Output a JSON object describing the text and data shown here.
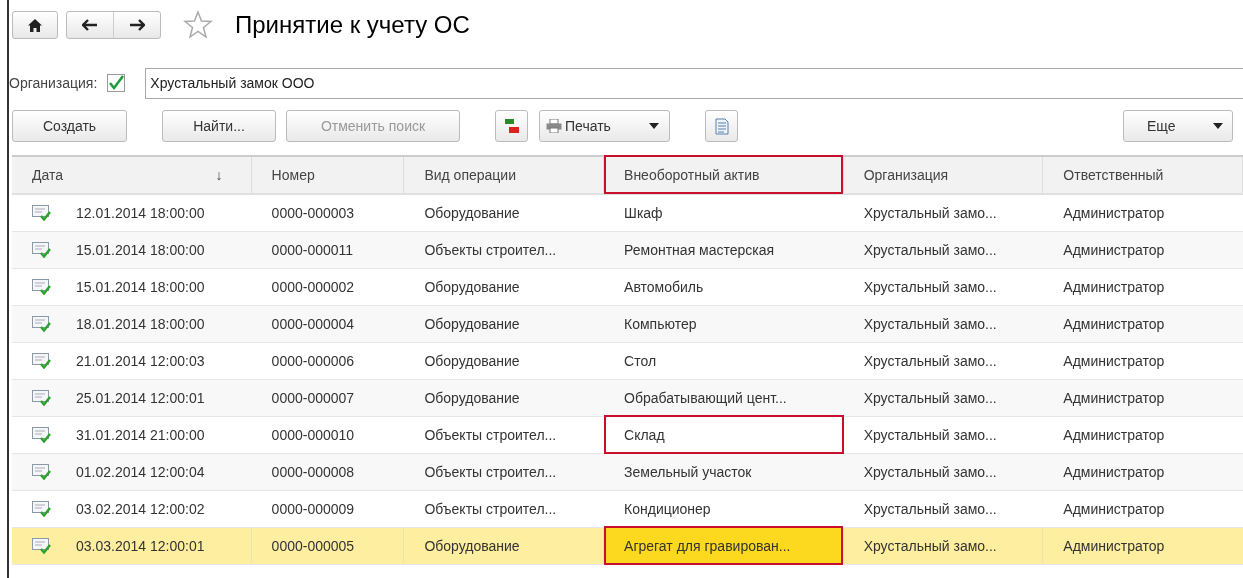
{
  "window": {
    "title": "Принятие к учету ОС",
    "favorite": false
  },
  "filter": {
    "label": "Организация:",
    "checked": true,
    "value": "Хрустальный замок ООО"
  },
  "toolbar": [
    {
      "kind": "button",
      "label": "Создать",
      "disabled": false
    },
    {
      "kind": "button",
      "label": "Найти...",
      "disabled": false
    },
    {
      "kind": "button",
      "label": "Отменить поиск",
      "disabled": true
    },
    {
      "kind": "dtkt"
    },
    {
      "kind": "print",
      "label": "Печать"
    },
    {
      "kind": "report"
    },
    {
      "kind": "more",
      "label": "Еще"
    }
  ],
  "table": {
    "columns": [
      {
        "label": "Дата",
        "sort_indicator": "↓",
        "marked": false
      },
      {
        "label": "Номер",
        "marked": false
      },
      {
        "label": "Вид операции",
        "marked": false
      },
      {
        "label": "Внеоборотный актив",
        "marked": true
      },
      {
        "label": "Организация",
        "marked": false
      },
      {
        "label": "Ответственный",
        "marked": false
      }
    ],
    "rows": [
      {
        "cells": [
          "12.01.2014 18:00:00",
          "0000-000003",
          "Оборудование",
          "Шкаф",
          "Хрустальный замо...",
          "Администратор"
        ],
        "selected": false,
        "marked": false
      },
      {
        "cells": [
          "15.01.2014 18:00:00",
          "0000-000011",
          "Объекты строител...",
          "Ремонтная мастерская",
          "Хрустальный замо...",
          "Администратор"
        ],
        "selected": false,
        "marked": false
      },
      {
        "cells": [
          "15.01.2014 18:00:00",
          "0000-000002",
          "Оборудование",
          "Автомобиль",
          "Хрустальный замо...",
          "Администратор"
        ],
        "selected": false,
        "marked": false
      },
      {
        "cells": [
          "18.01.2014 18:00:00",
          "0000-000004",
          "Оборудование",
          "Компьютер",
          "Хрустальный замо...",
          "Администратор"
        ],
        "selected": false,
        "marked": false
      },
      {
        "cells": [
          "21.01.2014 12:00:03",
          "0000-000006",
          "Оборудование",
          "Стол",
          "Хрустальный замо...",
          "Администратор"
        ],
        "selected": false,
        "marked": false
      },
      {
        "cells": [
          "25.01.2014 12:00:01",
          "0000-000007",
          "Оборудование",
          "Обрабатывающий цент...",
          "Хрустальный замо...",
          "Администратор"
        ],
        "selected": false,
        "marked": false
      },
      {
        "cells": [
          "31.01.2014 21:00:00",
          "0000-000010",
          "Объекты строител...",
          "Склад",
          "Хрустальный замо...",
          "Администратор"
        ],
        "selected": false,
        "marked": true
      },
      {
        "cells": [
          "01.02.2014 12:00:04",
          "0000-000008",
          "Объекты строител...",
          "Земельный участок",
          "Хрустальный замо...",
          "Администратор"
        ],
        "selected": false,
        "marked": false
      },
      {
        "cells": [
          "03.02.2014 12:00:02",
          "0000-000009",
          "Объекты строител...",
          "Кондиционер",
          "Хрустальный замо...",
          "Администратор"
        ],
        "selected": false,
        "marked": false
      },
      {
        "cells": [
          "03.03.2014 12:00:01",
          "0000-000005",
          "Оборудование",
          "Агрегат для гравирован...",
          "Хрустальный замо...",
          "Администратор"
        ],
        "selected": true,
        "marked": true
      }
    ]
  }
}
